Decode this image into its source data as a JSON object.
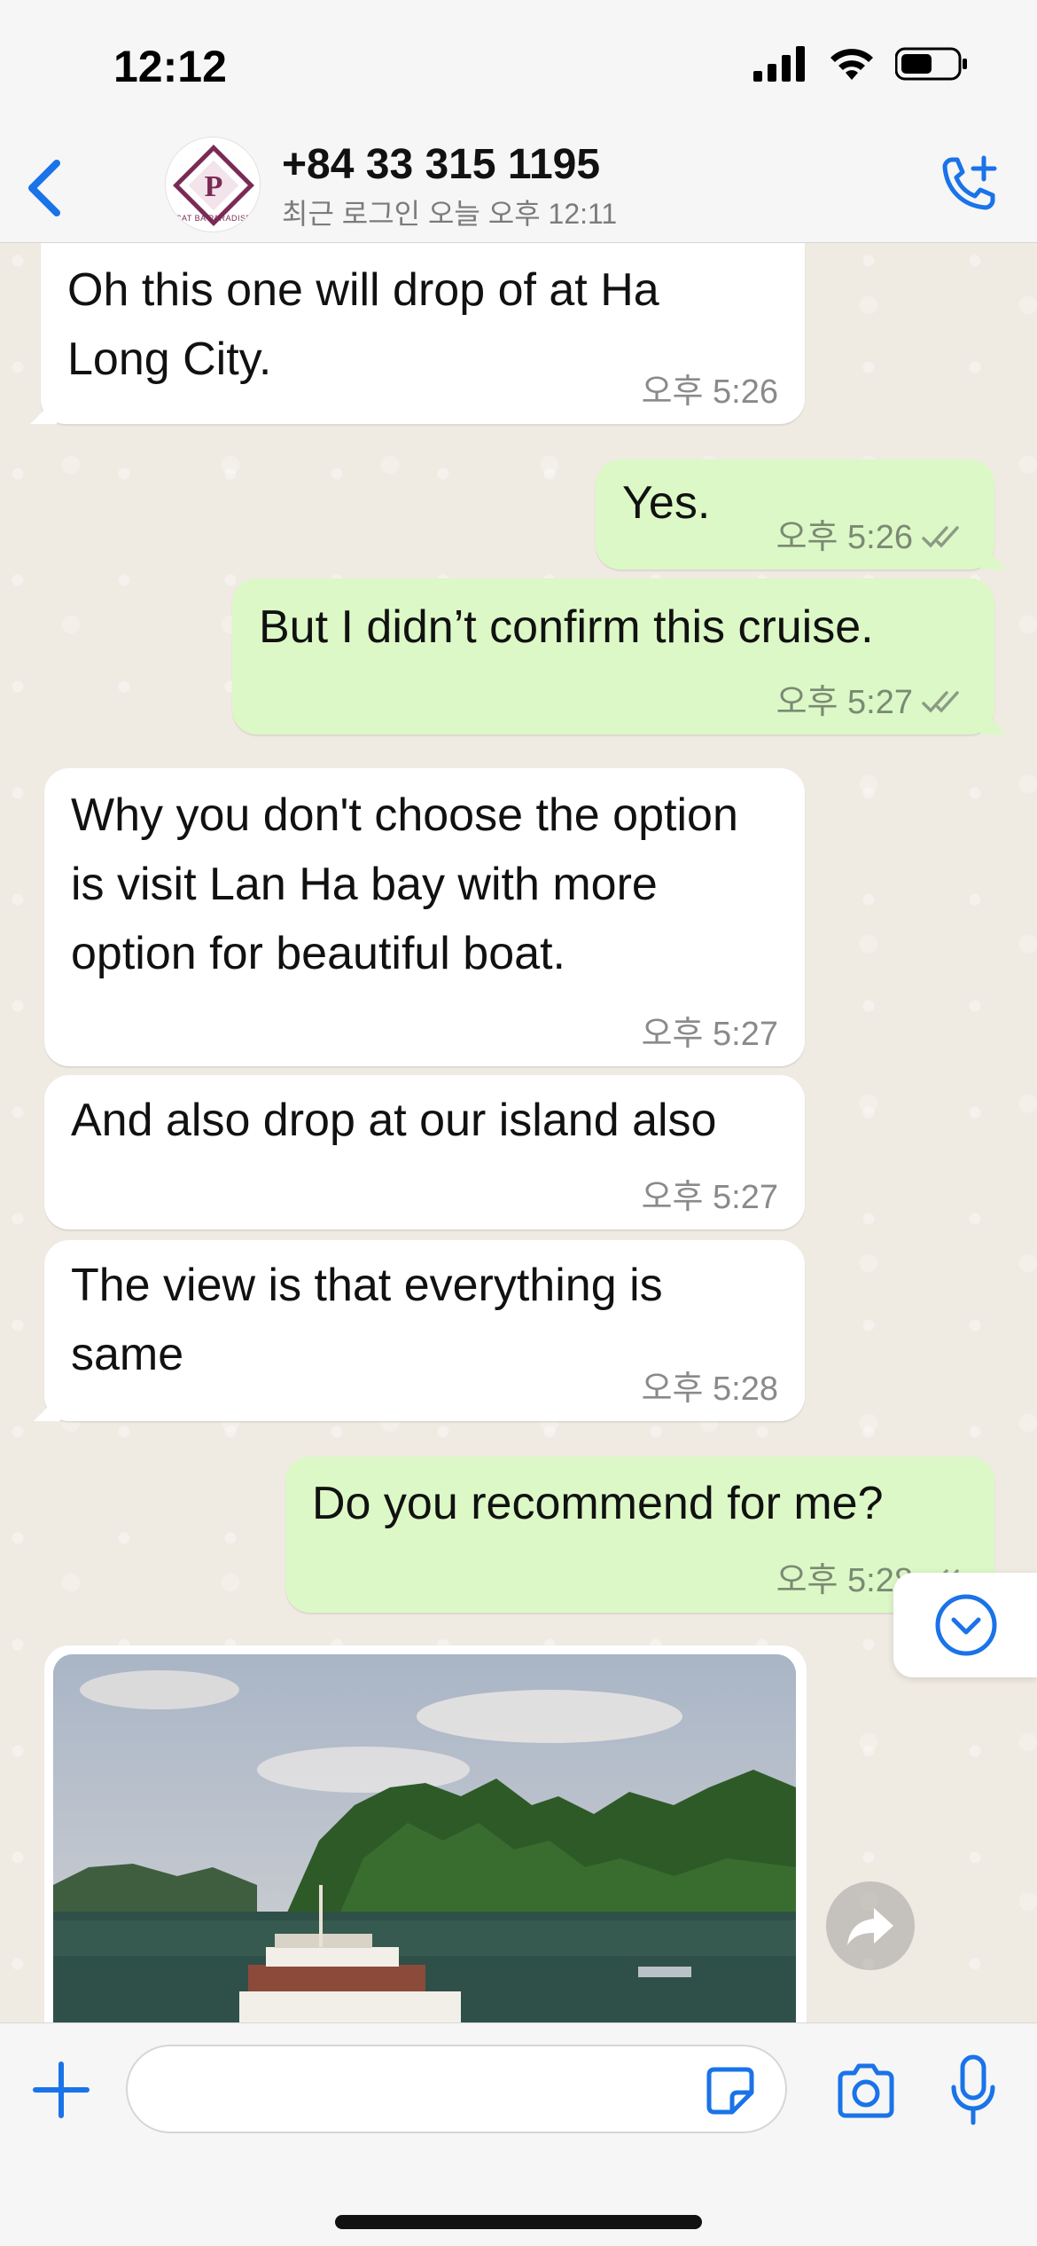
{
  "status_bar": {
    "time": "12:12"
  },
  "header": {
    "contact_name": "+84 33 315 1195",
    "last_seen": "최근 로그인 오늘 오후 12:11",
    "avatar_letter": "P",
    "avatar_caption": "CAT BA PARADISE"
  },
  "messages": [
    {
      "side": "in",
      "text": "Oh this one will drop of at Ha Long City.",
      "time": "오후 5:26"
    },
    {
      "side": "out",
      "text": "Yes.",
      "time": "오후 5:26"
    },
    {
      "side": "out",
      "text": "But I didn’t confirm this cruise.",
      "time": "오후 5:27"
    },
    {
      "side": "in",
      "text": "Why you don't choose the option is visit Lan Ha bay with more option for beautiful boat.",
      "time": "오후 5:27"
    },
    {
      "side": "in",
      "text": "And also drop at our island also",
      "time": "오후 5:27"
    },
    {
      "side": "in",
      "text": "The view is that everything is same",
      "time": "오후 5:28"
    },
    {
      "side": "out",
      "text": "Do you recommend for me?",
      "time": "오후 5:28"
    }
  ],
  "input": {
    "placeholder": ""
  },
  "colors": {
    "accent": "#1a73e8",
    "outgoing_bubble": "#dcf8c6",
    "incoming_bubble": "#ffffff",
    "chat_background": "#efeae2"
  }
}
